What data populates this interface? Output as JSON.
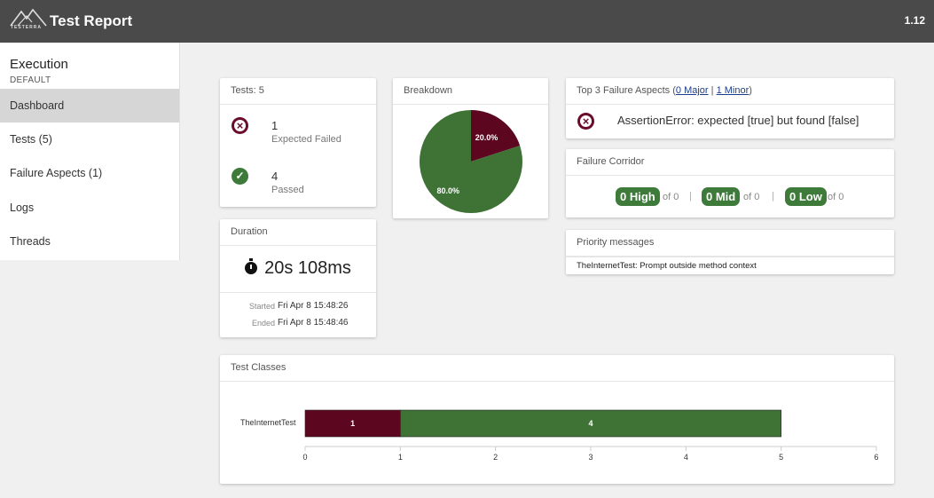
{
  "header": {
    "logo_text": "TESTERRA",
    "title": "Test Report",
    "version": "1.12"
  },
  "sidebar": {
    "title": "Execution",
    "subtitle": "DEFAULT",
    "items": [
      {
        "label": "Dashboard",
        "active": true
      },
      {
        "label": "Tests (5)",
        "active": false
      },
      {
        "label": "Failure Aspects (1)",
        "active": false
      },
      {
        "label": "Logs",
        "active": false
      },
      {
        "label": "Threads",
        "active": false
      }
    ]
  },
  "tests_card": {
    "title": "Tests: 5",
    "failed": {
      "count": "1",
      "label": "Expected Failed",
      "icon": "failed-icon"
    },
    "passed": {
      "count": "4",
      "label": "Passed",
      "icon": "passed-icon"
    }
  },
  "duration_card": {
    "title": "Duration",
    "value": "20s 108ms",
    "started_label": "Started",
    "started_value": "Fri Apr 8 15:48:26",
    "ended_label": "Ended",
    "ended_value": "Fri Apr 8 15:48:46"
  },
  "breakdown_card": {
    "title": "Breakdown",
    "chart_data": {
      "type": "pie",
      "slices": [
        {
          "label": "20.0%",
          "value": 20.0,
          "color": "#5c0620"
        },
        {
          "label": "80.0%",
          "value": 80.0,
          "color": "#3e7335"
        }
      ]
    }
  },
  "failure_aspects_card": {
    "title_prefix": "Top 3 Failure Aspects (",
    "major_link": "0 Major",
    "separator": " | ",
    "minor_link": "1 Minor",
    "title_suffix": ")",
    "items": [
      {
        "text": "AssertionError: expected [true] but found [false]",
        "icon": "failed-icon"
      }
    ]
  },
  "failure_corridor_card": {
    "title": "Failure Corridor",
    "high": {
      "value": "0 High",
      "of": "of 0"
    },
    "mid": {
      "value": "0 Mid",
      "of": "of 0"
    },
    "low": {
      "value": "0 Low",
      "of": "of 0"
    },
    "separator": "|",
    "color": "#3e7a3a"
  },
  "priority_card": {
    "title": "Priority messages",
    "messages": [
      "TheInternetTest: Prompt outside method context"
    ]
  },
  "test_classes_card": {
    "title": "Test Classes",
    "chart_data": {
      "type": "bar",
      "orientation": "horizontal",
      "stacked": true,
      "categories": [
        "TheInternetTest"
      ],
      "series": [
        {
          "values": [
            1
          ],
          "color": "#5c0620"
        },
        {
          "values": [
            4
          ],
          "color": "#3e7335"
        }
      ],
      "xlim": [
        0,
        6
      ],
      "xticks": [
        "0",
        "1",
        "2",
        "3",
        "4",
        "5",
        "6"
      ]
    }
  }
}
